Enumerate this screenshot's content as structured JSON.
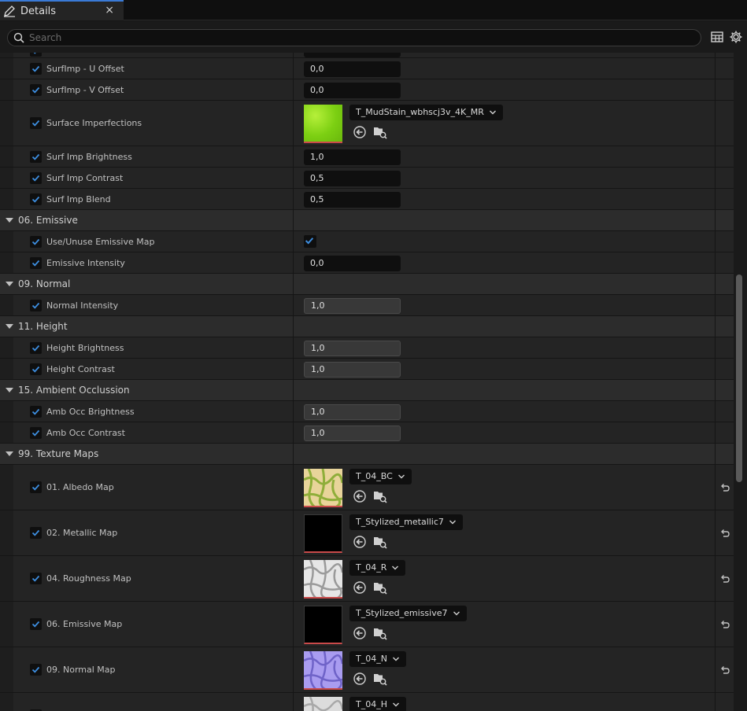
{
  "tab": {
    "title": "Details",
    "close": "×"
  },
  "search": {
    "placeholder": "Search",
    "value": ""
  },
  "rows": {
    "surfimp_u_offset": {
      "label": "SurfImp - U Offset",
      "value": "0,0"
    },
    "surfimp_v_offset": {
      "label": "SurfImp - V Offset",
      "value": "0,0"
    },
    "surface_imperfections": {
      "label": "Surface Imperfections",
      "asset": "T_MudStain_wbhscj3v_4K_MR"
    },
    "surf_imp_brightness": {
      "label": "Surf Imp Brightness",
      "value": "1,0"
    },
    "surf_imp_contrast": {
      "label": "Surf Imp Contrast",
      "value": "0,5"
    },
    "surf_imp_blend": {
      "label": "Surf Imp Blend",
      "value": "0,5"
    },
    "cat_emissive": {
      "label": "06. Emissive"
    },
    "use_emissive_map": {
      "label": "Use/Unuse Emissive Map",
      "checked": true
    },
    "emissive_intensity": {
      "label": "Emissive Intensity",
      "value": "0,0"
    },
    "cat_normal": {
      "label": "09. Normal"
    },
    "normal_intensity": {
      "label": "Normal Intensity",
      "value": "1,0"
    },
    "cat_height": {
      "label": "11. Height"
    },
    "height_brightness": {
      "label": "Height Brightness",
      "value": "1,0"
    },
    "height_contrast": {
      "label": "Height Contrast",
      "value": "1,0"
    },
    "cat_ao": {
      "label": "15. Ambient Occlussion"
    },
    "amb_occ_brightness": {
      "label": "Amb Occ Brightness",
      "value": "1,0"
    },
    "amb_occ_contrast": {
      "label": "Amb Occ Contrast",
      "value": "1,0"
    },
    "cat_texture_maps": {
      "label": "99. Texture Maps"
    },
    "albedo_map": {
      "label": "01. Albedo Map",
      "asset": "T_04_BC"
    },
    "metallic_map": {
      "label": "02. Metallic Map",
      "asset": "T_Stylized_metallic7"
    },
    "roughness_map": {
      "label": "04. Roughness Map",
      "asset": "T_04_R"
    },
    "emissive_map": {
      "label": "06. Emissive Map",
      "asset": "T_Stylized_emissive7"
    },
    "normal_map": {
      "label": "09. Normal Map",
      "asset": "T_04_N"
    },
    "height_map": {
      "asset": "T_04_H"
    }
  },
  "icons": {
    "tab": "pencil-icon",
    "search": "search-icon",
    "table_view": "table-view-icon",
    "settings": "gear-icon",
    "use_selected": "use-selected-arrow-icon",
    "browse": "browse-folder-icon",
    "reset": "reset-to-default-icon",
    "checkbox": "checkmark-icon",
    "expand": "caret-down-icon",
    "dropdown": "chevron-down-icon"
  },
  "colors": {
    "accent": "#3a7ad6",
    "check": "#3d8ee0",
    "thumbnail_border": "#c94a4a"
  }
}
